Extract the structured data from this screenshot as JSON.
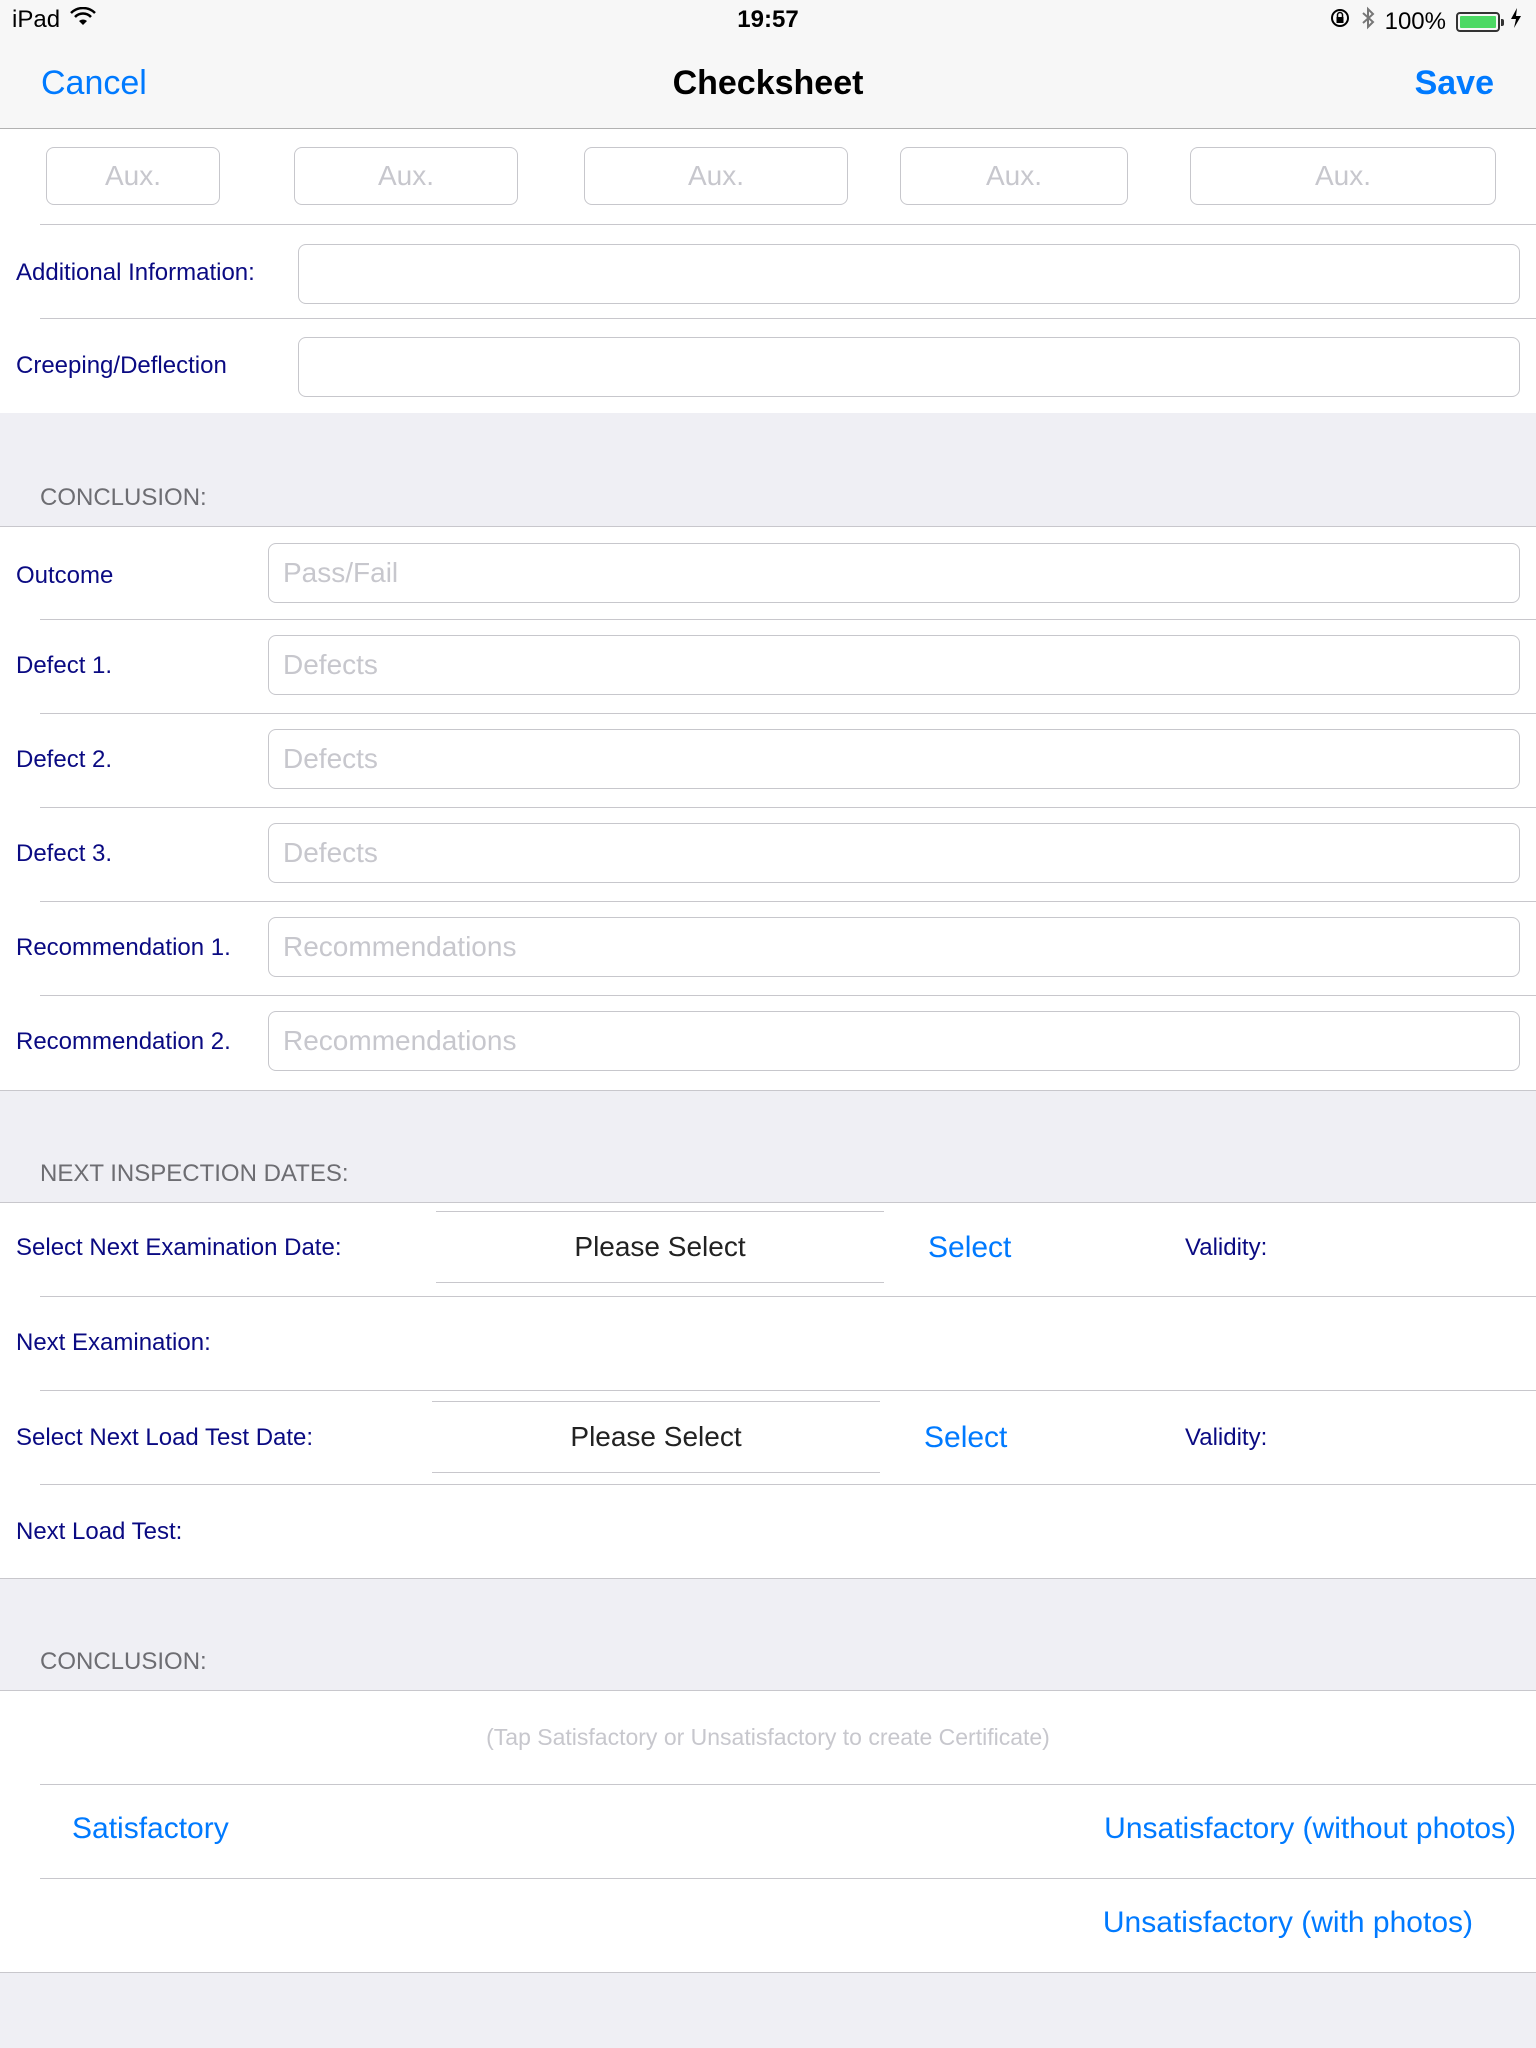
{
  "status_bar": {
    "device": "iPad",
    "time": "19:57",
    "battery": "100%",
    "battery_level": 1.0
  },
  "nav": {
    "cancel": "Cancel",
    "title": "Checksheet",
    "save": "Save"
  },
  "aux_placeholders": [
    "Aux.",
    "Aux.",
    "Aux.",
    "Aux.",
    "Aux."
  ],
  "details": {
    "additional_info_label": "Additional Information:",
    "additional_info_value": "",
    "creeping_label": "Creeping/Deflection",
    "creeping_value": ""
  },
  "conclusion": {
    "header": "CONCLUSION:",
    "rows": [
      {
        "label": "Outcome",
        "placeholder": "Pass/Fail"
      },
      {
        "label": "Defect 1.",
        "placeholder": "Defects"
      },
      {
        "label": "Defect 2.",
        "placeholder": "Defects"
      },
      {
        "label": "Defect 3.",
        "placeholder": "Defects"
      },
      {
        "label": "Recommendation 1.",
        "placeholder": "Recommendations"
      },
      {
        "label": "Recommendation 2.",
        "placeholder": "Recommendations"
      }
    ]
  },
  "next_inspection": {
    "header": "NEXT INSPECTION DATES:",
    "exam_date_label": "Select Next Examination Date:",
    "exam_picker": "Please Select",
    "exam_select": "Select",
    "exam_validity": "Validity:",
    "next_exam_label": "Next Examination:",
    "load_date_label": "Select Next Load Test Date:",
    "load_picker": "Please Select",
    "load_select": "Select",
    "load_validity": "Validity:",
    "next_load_label": "Next Load Test:"
  },
  "certificate": {
    "header": "CONCLUSION:",
    "hint": "(Tap Satisfactory or Unsatisfactory to create Certificate)",
    "satisfactory": "Satisfactory",
    "unsat_without": "Unsatisfactory (without photos)",
    "unsat_with": "Unsatisfactory (with photos)"
  },
  "colors": {
    "accent": "#007aff",
    "label": "#0a0a82",
    "background": "#efeff4"
  }
}
